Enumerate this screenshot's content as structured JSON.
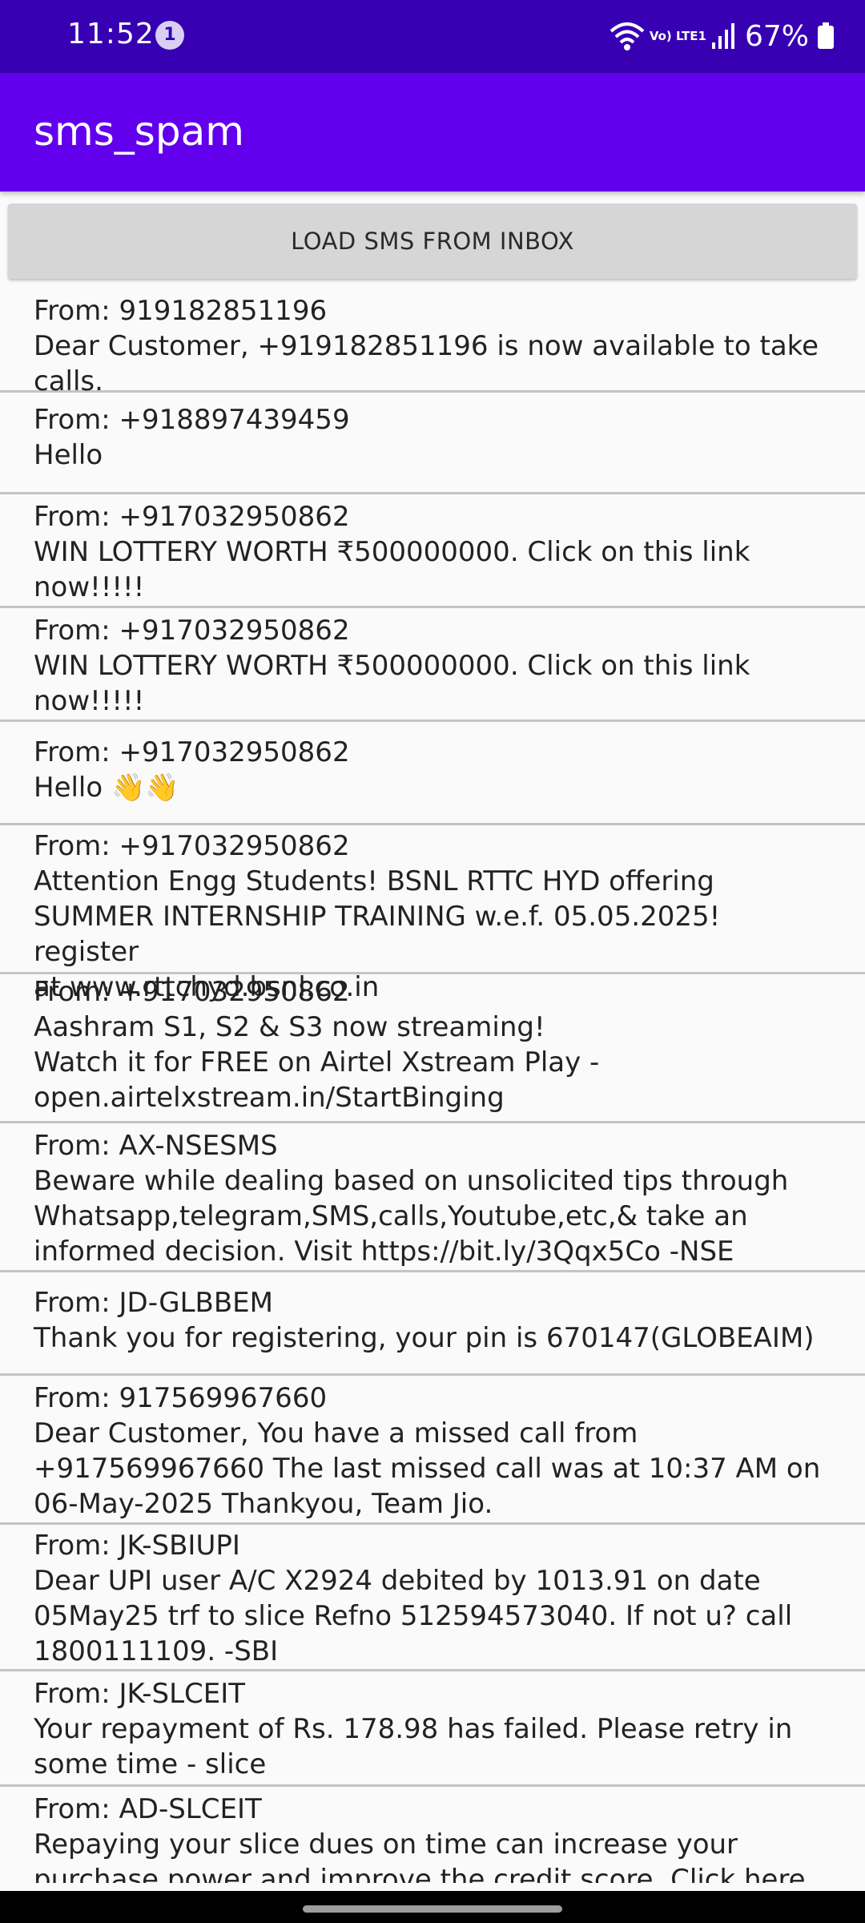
{
  "status_bar": {
    "time": "11:52",
    "notification_count": "1",
    "network_label": "Vo) LTE1",
    "battery": "67%",
    "icons": [
      "wifi-icon",
      "volte-icon",
      "signal-icon",
      "battery-icon"
    ]
  },
  "app_bar": {
    "title": "sms_spam"
  },
  "load_button": {
    "label": "LOAD SMS FROM INBOX"
  },
  "messages": [
    {
      "from": "From: 919182851196",
      "body": "Dear Customer, +919182851196 is now available to take\ncalls."
    },
    {
      "from": "From: +918897439459",
      "body": "Hello"
    },
    {
      "from": "From: +917032950862",
      "body": "WIN LOTTERY WORTH ₹500000000. Click on this link\nnow!!!!!"
    },
    {
      "from": "From: +917032950862",
      "body": "WIN LOTTERY WORTH ₹500000000. Click on this link\nnow!!!!!"
    },
    {
      "from": "From: +917032950862",
      "body": "Hello 👋👋"
    },
    {
      "from": "From: +917032950862",
      "body": "Attention Engg Students! BSNL RTTC HYD offering\nSUMMER INTERNSHIP TRAINING w.e.f. 05.05.2025! register\nat www.rttchyd.bsnl.co.in"
    },
    {
      "from": "From: +917032950862",
      "body": "Aashram S1, S2 & S3 now streaming!\nWatch it for FREE on Airtel Xstream Play -\nopen.airtelxstream.in/StartBinging"
    },
    {
      "from": "From: AX-NSESMS",
      "body": "Beware while dealing based on unsolicited tips through\nWhatsapp,telegram,SMS,calls,Youtube,etc,& take an\ninformed decision. Visit https://bit.ly/3Qqx5Co -NSE"
    },
    {
      "from": "From: JD-GLBBEM",
      "body": "Thank you for registering, your pin is 670147(GLOBEAIM)"
    },
    {
      "from": "From: 917569967660",
      "body": "Dear Customer, You have a missed call from\n+917569967660 The last missed call was at 10:37 AM on\n06-May-2025 Thankyou, Team Jio."
    },
    {
      "from": "From: JK-SBIUPI",
      "body": "Dear UPI user A/C X2924 debited by 1013.91 on date\n05May25 trf to slice Refno 512594573040. If not u? call\n1800111109. -SBI"
    },
    {
      "from": "From: JK-SLCEIT",
      "body": "Your repayment of Rs. 178.98 has failed. Please retry in\nsome time - slice"
    },
    {
      "from": "From: AD-SLCEIT",
      "body": "Repaying your slice dues on time can increase your\npurchase power and improve the credit score. Click here"
    }
  ],
  "colors": {
    "status_bar": "#3700b3",
    "app_bar": "#6200ee",
    "button": "#d6d6d6",
    "background": "#fafafa",
    "divider": "#c4c4c4"
  }
}
